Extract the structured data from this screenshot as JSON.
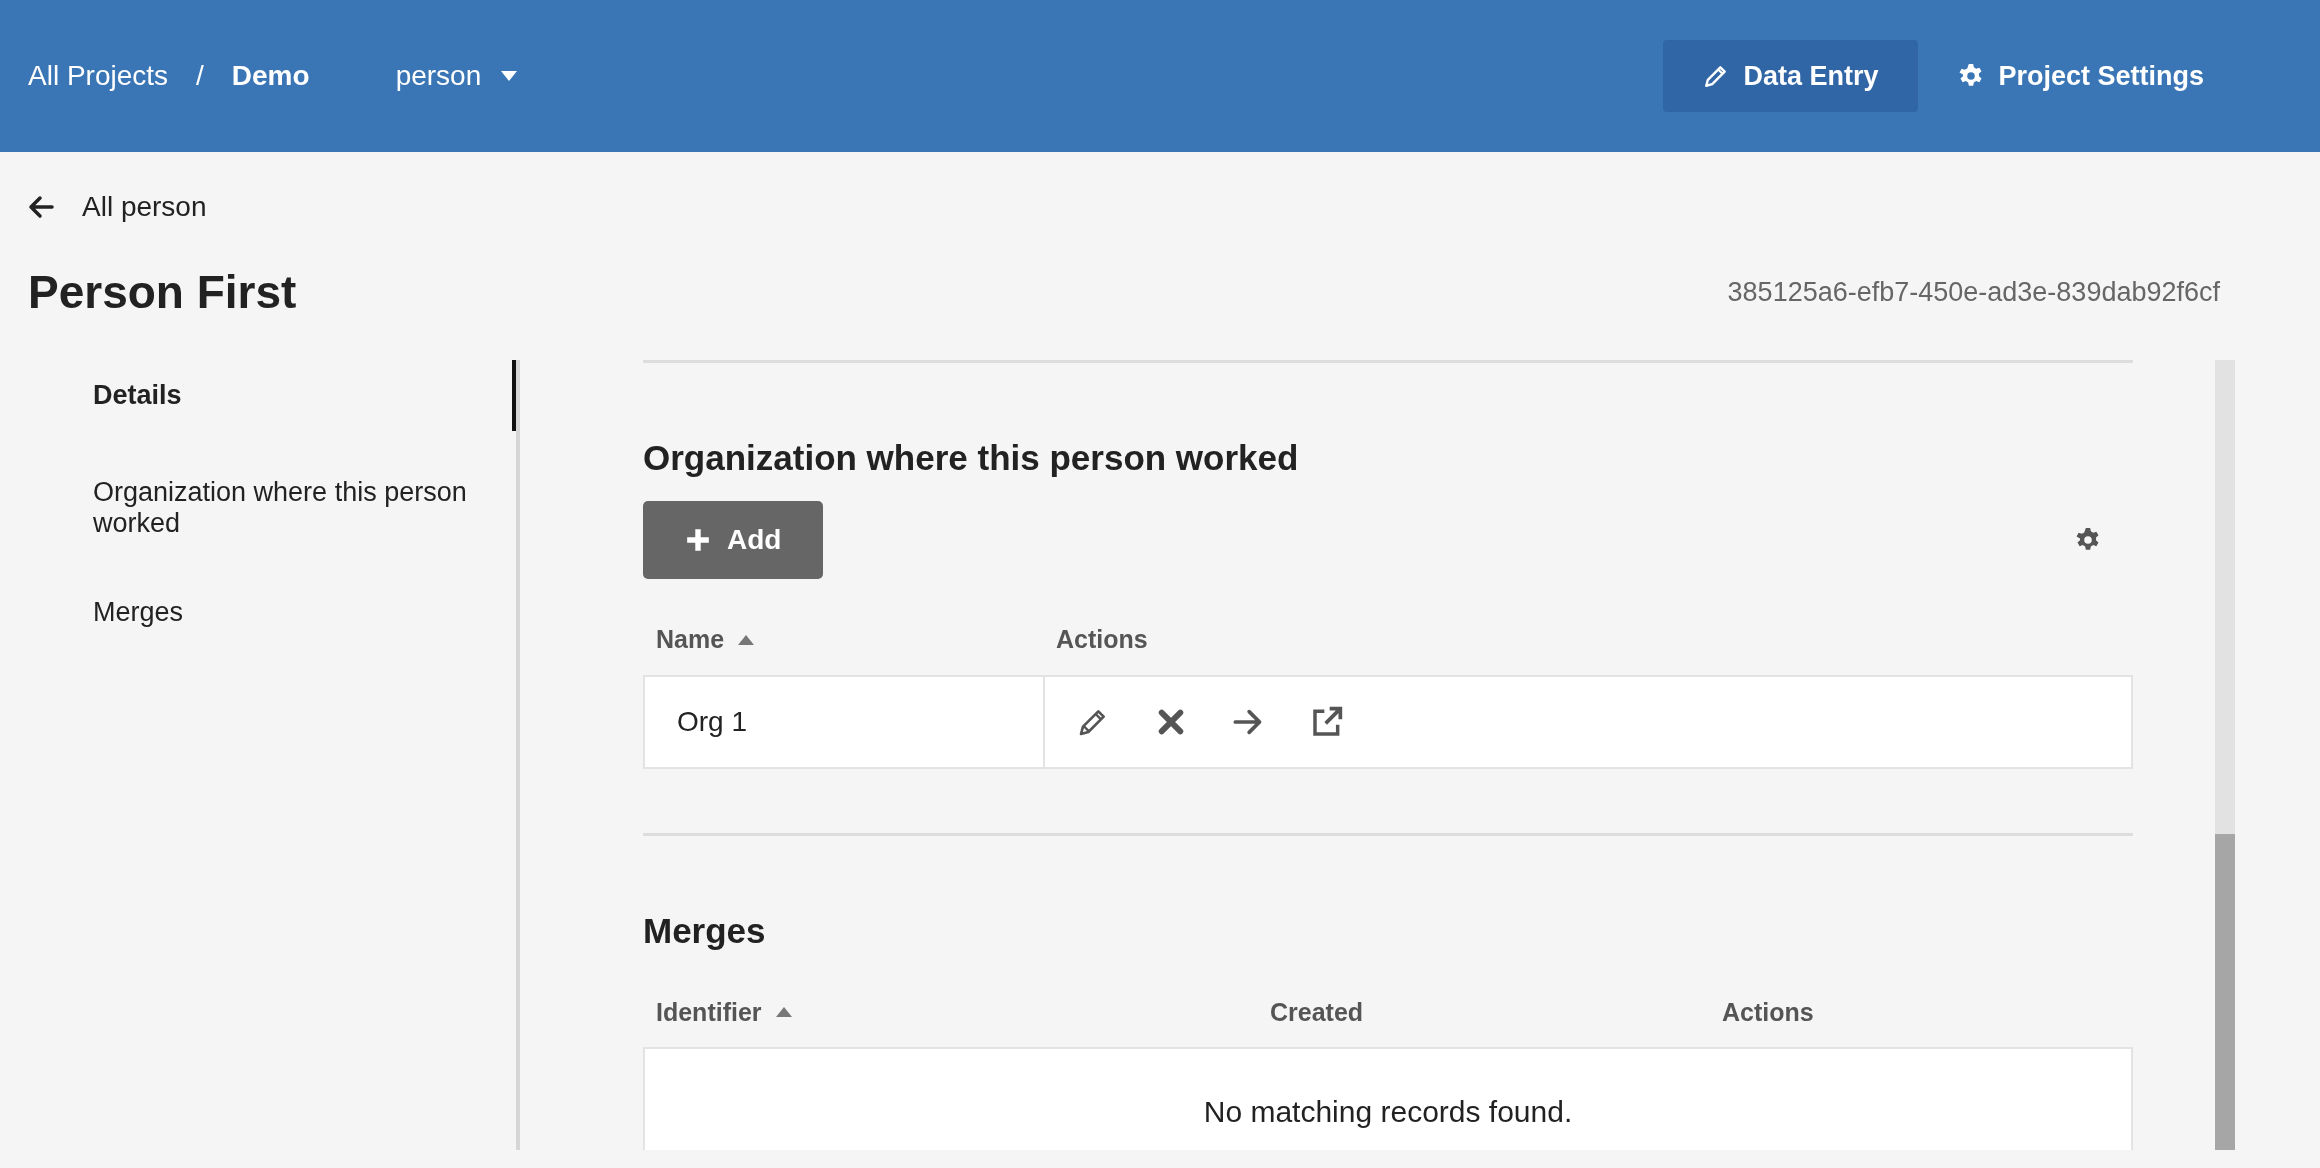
{
  "navbar": {
    "breadcrumb": [
      {
        "label": "All Projects"
      },
      {
        "label": "Demo"
      }
    ],
    "separator": "/",
    "type_menu": "person",
    "nav_items": [
      {
        "label": "Data Entry",
        "kind": "pencil",
        "selected": true
      },
      {
        "label": "Project Settings",
        "kind": "gear",
        "selected": false
      }
    ]
  },
  "back_link": "All person",
  "title": "Person First",
  "record_id": "385125a6-efb7-450e-ad3e-839dab92f6cf",
  "sidebar": {
    "items": [
      {
        "label": "Details",
        "selected": true
      },
      {
        "label": "Organization where this person worked",
        "selected": false
      },
      {
        "label": "Merges",
        "selected": false
      }
    ]
  },
  "sections": [
    {
      "heading": "Organization where this person worked",
      "add_button": "Add",
      "columns": [
        {
          "label": "Name",
          "sorted": true
        },
        {
          "label": "Actions",
          "sorted": false
        }
      ],
      "rows": [
        {
          "cells": [
            "Org 1"
          ]
        }
      ]
    },
    {
      "heading": "Merges",
      "columns": [
        {
          "label": "Identifier",
          "sorted": true
        },
        {
          "label": "Created",
          "sorted": false
        },
        {
          "label": "Actions",
          "sorted": false
        }
      ],
      "empty_message": "No matching records found."
    }
  ]
}
